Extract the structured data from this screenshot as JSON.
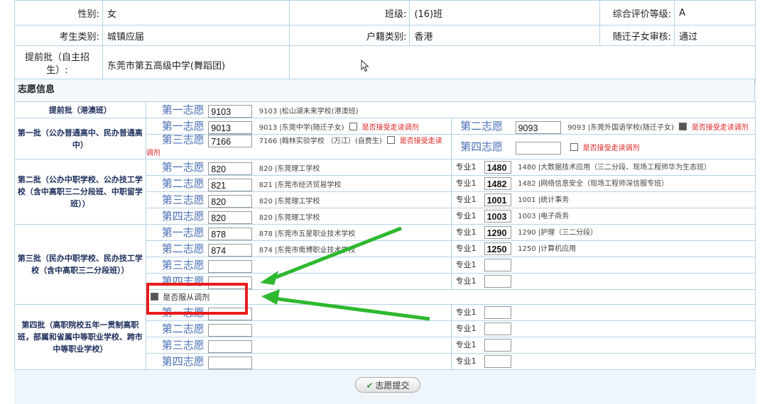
{
  "info": {
    "gender_label": "性别:",
    "gender": "女",
    "class_label": "班级:",
    "class": "(16)班",
    "grade_label": "综合评价等级:",
    "grade": "A",
    "type_label": "考生类别:",
    "type": "城镇应届",
    "household_label": "户籍类别:",
    "household": "香港",
    "migrant_label": "随迁子女审核:",
    "migrant": "通过",
    "early_label": "提前批（自主招生）:",
    "early": "东莞市第五高级中学(舞蹈团)"
  },
  "section_title": "志愿信息",
  "labels": {
    "wish1": "第一志愿",
    "wish2": "第二志愿",
    "wish3": "第三志愿",
    "wish4": "第四志愿",
    "accept": "是否接受走读调剂",
    "accept_short": "是否接受走读",
    "accept_tail": "调剂",
    "major1": "专业1",
    "obey": "是否服从调剂",
    "submit": "志愿提交"
  },
  "batches": {
    "hk": {
      "name": "提前批（港澳班）",
      "w1_code": "9103",
      "w1_desc": "9103 |松山湖未来学校(港澳班)"
    },
    "b1": {
      "name": "第一批（公办普通高中、民办普通高中）",
      "w1_code": "9013",
      "w1_desc": "9013 |东莞中学(随迁子女)",
      "w2_code": "9093",
      "w2_desc": "9093 |东莞外国语学校(随迁子女)",
      "w3_code": "7166",
      "w3_desc": "7166 |翰林实验学校 （万江）(自费生)"
    },
    "b2": {
      "name": "第二批（公办中职学校、公办技工学校（含中高职三二分段班、中职留学班））",
      "rows": [
        {
          "code": "820",
          "desc": "820 |东莞理工学校",
          "mcode": "1480",
          "mdesc": "1480 |大数据技术应用（三二分段、现场工程师华为生态班）"
        },
        {
          "code": "821",
          "desc": "821 |东莞市经济贸易学校",
          "mcode": "1482",
          "mdesc": "1482 |网络信息安全（现场工程师深信服专班）"
        },
        {
          "code": "820",
          "desc": "820 |东莞理工学校",
          "mcode": "1001",
          "mdesc": "1001 |统计事务"
        },
        {
          "code": "820",
          "desc": "820 |东莞理工学校",
          "mcode": "1003",
          "mdesc": "1003 |电子商务"
        }
      ]
    },
    "b3": {
      "name": "第三批（民办中职学校、民办技工学校（含中高职三二分段班））",
      "rows": [
        {
          "code": "878",
          "desc": "878 |东莞市五星职业技术学校",
          "mcode": "1290",
          "mdesc": "1290 |护理（三二分段）"
        },
        {
          "code": "874",
          "desc": "874 |东莞市南博职业技术学校",
          "mcode": "1250",
          "mdesc": "1250 |计算机应用"
        }
      ]
    },
    "b4": {
      "name": "第四批（高职院校五年一贯制高职班，部属和省属中等职业学校、跨市中等职业学校）"
    }
  },
  "colors": {
    "annotation_red": "#ea1b1b",
    "arrow_green": "#2eb82e",
    "border": "#b5d3e6"
  }
}
